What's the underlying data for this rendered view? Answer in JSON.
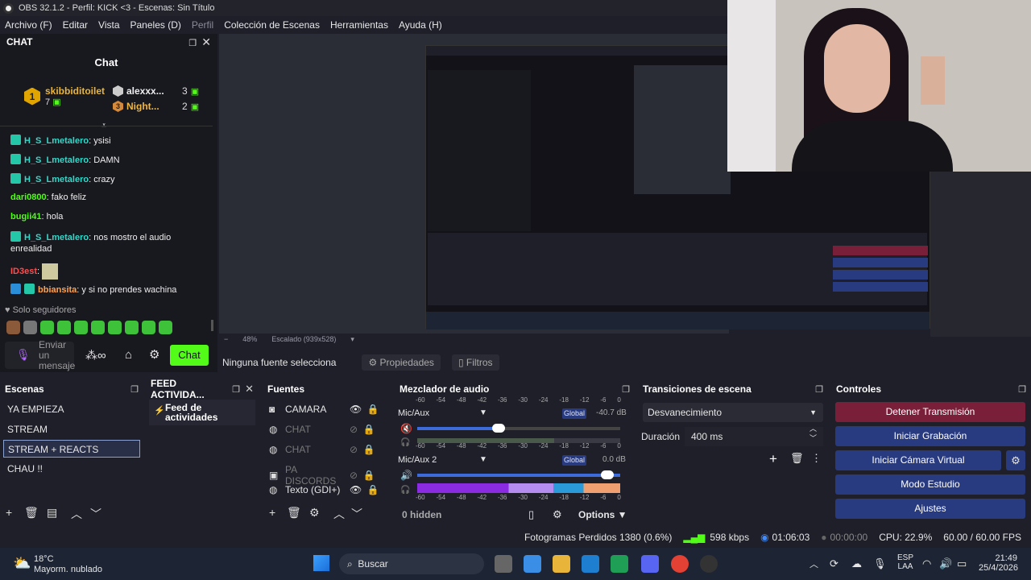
{
  "window_title": "OBS 32.1.2 - Perfil: KICK <3 - Escenas: Sin Título",
  "menu": [
    "Archivo (F)",
    "Editar",
    "Vista",
    "Paneles (D)",
    "Perfil",
    "Colección de Escenas",
    "Herramientas",
    "Ayuda (H)"
  ],
  "chat": {
    "dock_title": "CHAT",
    "inner_title": "Chat",
    "top": [
      {
        "rank": "1",
        "name": "skibbiditoilet",
        "count": "7"
      },
      {
        "rank": "",
        "name": "alexxx...",
        "count": "3"
      },
      {
        "rank": "3",
        "name": "Night...",
        "count": "2"
      }
    ],
    "messages": [
      {
        "user": "H_S_Lmetalero",
        "text": ": ysisi"
      },
      {
        "user": "H_S_Lmetalero",
        "text": ": DAMN"
      },
      {
        "user": "H_S_Lmetalero",
        "text": ": crazy"
      },
      {
        "user": "dari0800",
        "text": ": fako feliz"
      },
      {
        "user": "bugii41",
        "text": ": hola"
      },
      {
        "user": "H_S_Lmetalero",
        "text": ": nos mostro el audio"
      },
      {
        "user": "",
        "text": "enrealidad"
      },
      {
        "user": "ID3est",
        "text": ":"
      },
      {
        "user": "bbiansita",
        "text": ": y si no prendes wachina"
      }
    ],
    "followers_only": "Solo seguidores",
    "input_placeholder": "Enviar un mensaje",
    "send_button": "Chat",
    "gift_icon": "gift-icon"
  },
  "preview": {
    "zoom": "48%",
    "scale": "Escalado (939x528)"
  },
  "properties_bar": {
    "no_source": "Ninguna fuente selecciona",
    "properties": "Propiedades",
    "filters": "Filtros"
  },
  "scenes": {
    "title": "Escenas",
    "items": [
      "YA EMPIEZA",
      "STREAM",
      "STREAM + REACTS",
      "CHAU !!"
    ],
    "selected": "STREAM + REACTS"
  },
  "feed": {
    "title": "FEED ACTIVIDA...",
    "item": "Feed de actividades"
  },
  "sources": {
    "title": "Fuentes",
    "items": [
      {
        "name": "CAMARA",
        "visible": true
      },
      {
        "name": "CHAT",
        "visible": false
      },
      {
        "name": "CHAT",
        "visible": false
      },
      {
        "name": "PA DISCORDS",
        "visible": false
      },
      {
        "name": "Texto (GDI+)",
        "visible": true
      }
    ]
  },
  "mixer": {
    "title": "Mezclador de audio",
    "scale": [
      "-60",
      "-54",
      "-48",
      "-42",
      "-36",
      "-30",
      "-24",
      "-18",
      "-12",
      "-6",
      "0"
    ],
    "channels": [
      {
        "name": "Mic/Aux",
        "tag": "Global",
        "db": "-40.7 dB",
        "volume": 0.4,
        "muted": true
      },
      {
        "name": "Mic/Aux 2",
        "tag": "Global",
        "db": "0.0 dB",
        "volume": 1.0,
        "muted": false
      }
    ],
    "hidden": "0 hidden",
    "options": "Options"
  },
  "transitions": {
    "title": "Transiciones de escena",
    "selected": "Desvanecimiento",
    "duration_label": "Duración",
    "duration_value": "400 ms"
  },
  "controls": {
    "title": "Controles",
    "buttons": [
      "Detener Transmisión",
      "Iniciar Grabación",
      "Iniciar Cámara Virtual",
      "Modo Estudio",
      "Ajustes"
    ]
  },
  "status": {
    "dropped": "Fotogramas Perdidos 1380 (0.6%)",
    "bitrate": "598 kbps",
    "stream_time": "01:06:03",
    "rec_time": "00:00:00",
    "cpu": "CPU: 22.9%",
    "fps": "60.00 / 60.00 FPS"
  },
  "taskbar": {
    "weather_temp": "18°C",
    "weather_desc": "Mayorm. nublado",
    "search": "Buscar",
    "lang1": "ESP",
    "lang2": "LAA",
    "time": "21:49",
    "date": "25/4/2026"
  },
  "colors": {
    "kick_green": "#53fc18",
    "stop_red": "#7a1f3a",
    "control_blue": "#283a80",
    "accent": "#e0a500"
  }
}
